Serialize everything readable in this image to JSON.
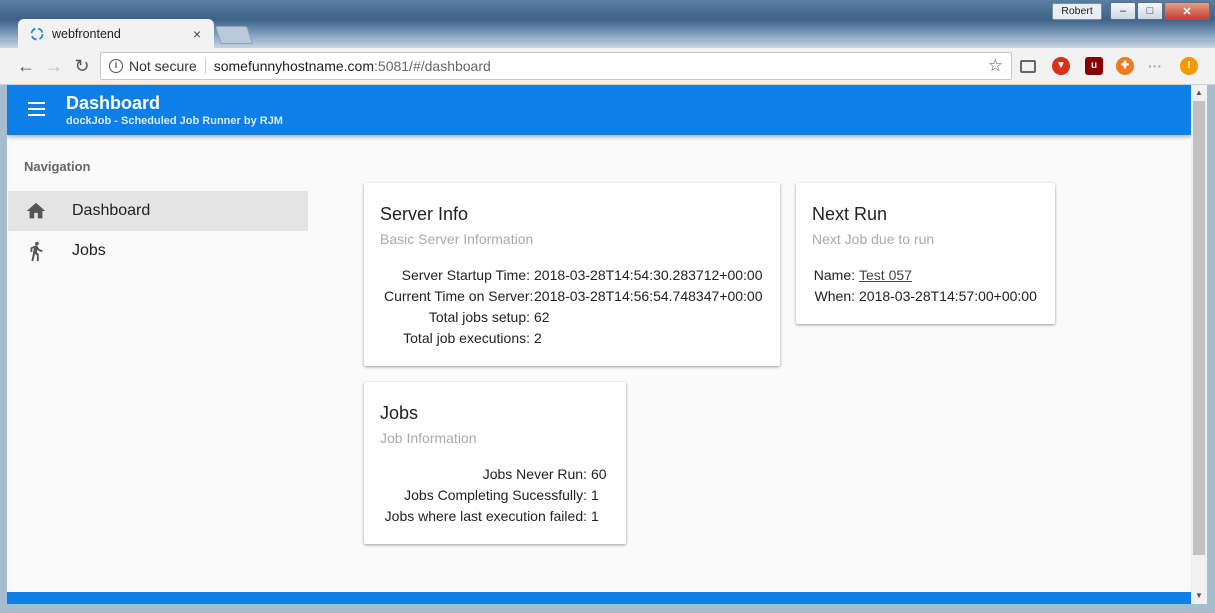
{
  "browser": {
    "tab_title": "webfrontend",
    "tab_close": "×",
    "user_name": "Robert",
    "security_label": "Not secure",
    "url_host": "somefunnyhostname.com",
    "url_path": ":5081/#/dashboard",
    "bookmark_star": "☆",
    "win_min": "–",
    "win_max": "□",
    "win_close": "✕",
    "back": "←",
    "forward": "→",
    "reload": "↻"
  },
  "appbar": {
    "title": "Dashboard",
    "subtitle": "dockJob - Scheduled Job Runner by RJM"
  },
  "nav": {
    "heading": "Navigation",
    "items": [
      {
        "label": "Dashboard",
        "icon": "home-icon",
        "active": true
      },
      {
        "label": "Jobs",
        "icon": "runner-icon",
        "active": false
      }
    ]
  },
  "server_info": {
    "title": "Server Info",
    "subtitle": "Basic Server Information",
    "rows": [
      {
        "key": "Server Startup Time:",
        "value": "2018-03-28T14:54:30.283712+00:00"
      },
      {
        "key": "Current Time on Server:",
        "value": "2018-03-28T14:56:54.748347+00:00"
      },
      {
        "key": "Total jobs setup:",
        "value": "62"
      },
      {
        "key": "Total job executions:",
        "value": "2"
      }
    ]
  },
  "next_run": {
    "title": "Next Run",
    "subtitle": "Next Job due to run",
    "name_key": "Name:",
    "name_value": "Test 057",
    "when_key": "When:",
    "when_value": "2018-03-28T14:57:00+00:00"
  },
  "jobs": {
    "title": "Jobs",
    "subtitle": "Job Information",
    "rows": [
      {
        "key": "Jobs Never Run:",
        "value": "60"
      },
      {
        "key": "Jobs Completing Sucessfully:",
        "value": "1"
      },
      {
        "key": "Jobs where last execution failed:",
        "value": "1"
      }
    ]
  },
  "colors": {
    "accent": "#0d7fe6",
    "nav_active_bg": "#e4e4e4"
  }
}
